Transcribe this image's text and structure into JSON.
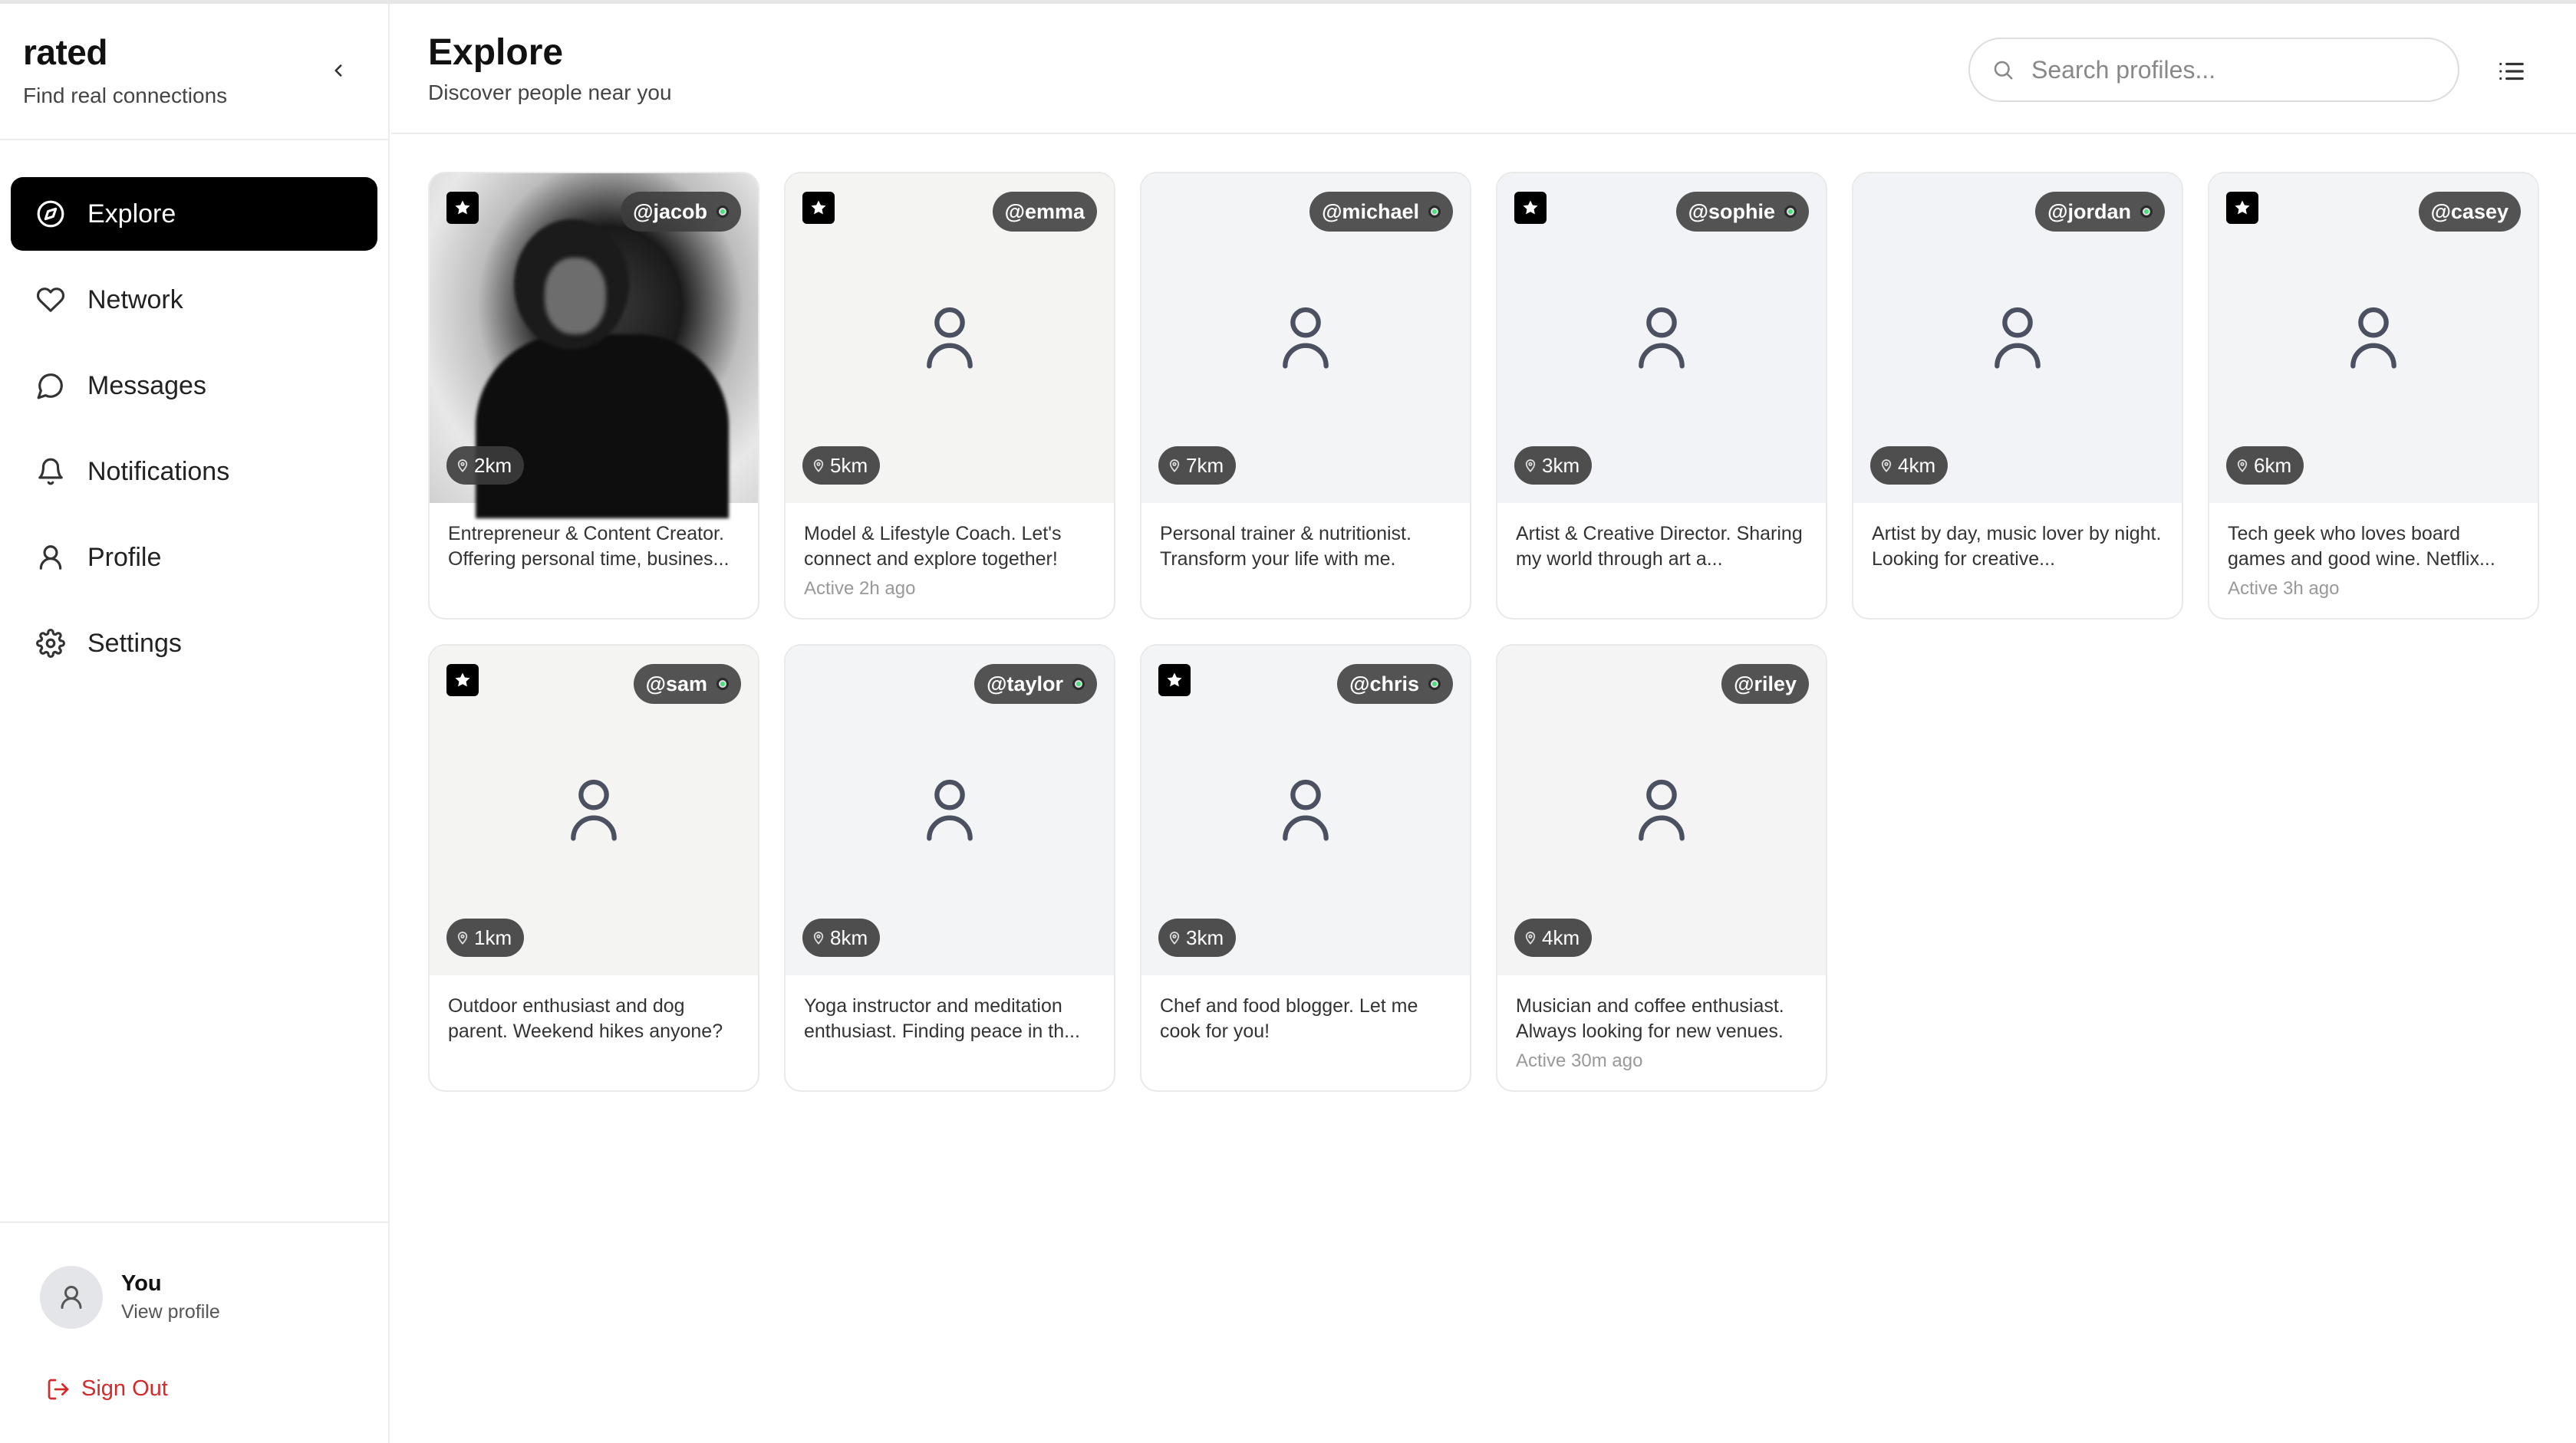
{
  "app": {
    "name": "rated",
    "tagline": "Find real connections"
  },
  "nav": [
    {
      "label": "Explore",
      "icon": "compass-icon",
      "active": true
    },
    {
      "label": "Network",
      "icon": "heart-icon",
      "active": false
    },
    {
      "label": "Messages",
      "icon": "message-icon",
      "active": false
    },
    {
      "label": "Notifications",
      "icon": "bell-icon",
      "active": false
    },
    {
      "label": "Profile",
      "icon": "user-icon",
      "active": false
    },
    {
      "label": "Settings",
      "icon": "gear-icon",
      "active": false
    }
  ],
  "user": {
    "name": "You",
    "sub": "View profile",
    "signout": "Sign Out"
  },
  "header": {
    "title": "Explore",
    "subtitle": "Discover people near you"
  },
  "search": {
    "placeholder": "Search profiles..."
  },
  "profiles": [
    {
      "handle": "@jacob",
      "starred": true,
      "online": true,
      "distance": "2km",
      "bio": "Entrepreneur & Content Creator. Offering personal time, busines...",
      "active": "",
      "photo": true
    },
    {
      "handle": "@emma",
      "starred": true,
      "online": false,
      "distance": "5km",
      "bio": "Model & Lifestyle Coach. Let's connect and explore together!",
      "active": "Active 2h ago",
      "photo": false
    },
    {
      "handle": "@michael",
      "starred": false,
      "online": true,
      "distance": "7km",
      "bio": "Personal trainer & nutritionist. Transform your life with me.",
      "active": "",
      "photo": false
    },
    {
      "handle": "@sophie",
      "starred": true,
      "online": true,
      "distance": "3km",
      "bio": "Artist & Creative Director. Sharing my world through art a...",
      "active": "",
      "photo": false
    },
    {
      "handle": "@jordan",
      "starred": false,
      "online": true,
      "distance": "4km",
      "bio": "Artist by day, music lover by night. Looking for creative...",
      "active": "",
      "photo": false
    },
    {
      "handle": "@casey",
      "starred": true,
      "online": false,
      "distance": "6km",
      "bio": "Tech geek who loves board games and good wine. Netflix...",
      "active": "Active 3h ago",
      "photo": false
    },
    {
      "handle": "@sam",
      "starred": true,
      "online": true,
      "distance": "1km",
      "bio": "Outdoor enthusiast and dog parent. Weekend hikes anyone?",
      "active": "",
      "photo": false
    },
    {
      "handle": "@taylor",
      "starred": false,
      "online": true,
      "distance": "8km",
      "bio": "Yoga instructor and meditation enthusiast. Finding peace in th...",
      "active": "",
      "photo": false
    },
    {
      "handle": "@chris",
      "starred": true,
      "online": true,
      "distance": "3km",
      "bio": "Chef and food blogger. Let me cook for you!",
      "active": "",
      "photo": false
    },
    {
      "handle": "@riley",
      "starred": false,
      "online": false,
      "distance": "4km",
      "bio": "Musician and coffee enthusiast. Always looking for new venues.",
      "active": "Active 30m ago",
      "photo": false
    }
  ],
  "colors": {
    "accent": "#000000",
    "online": "#4ade80",
    "signout": "#d12b2b"
  }
}
